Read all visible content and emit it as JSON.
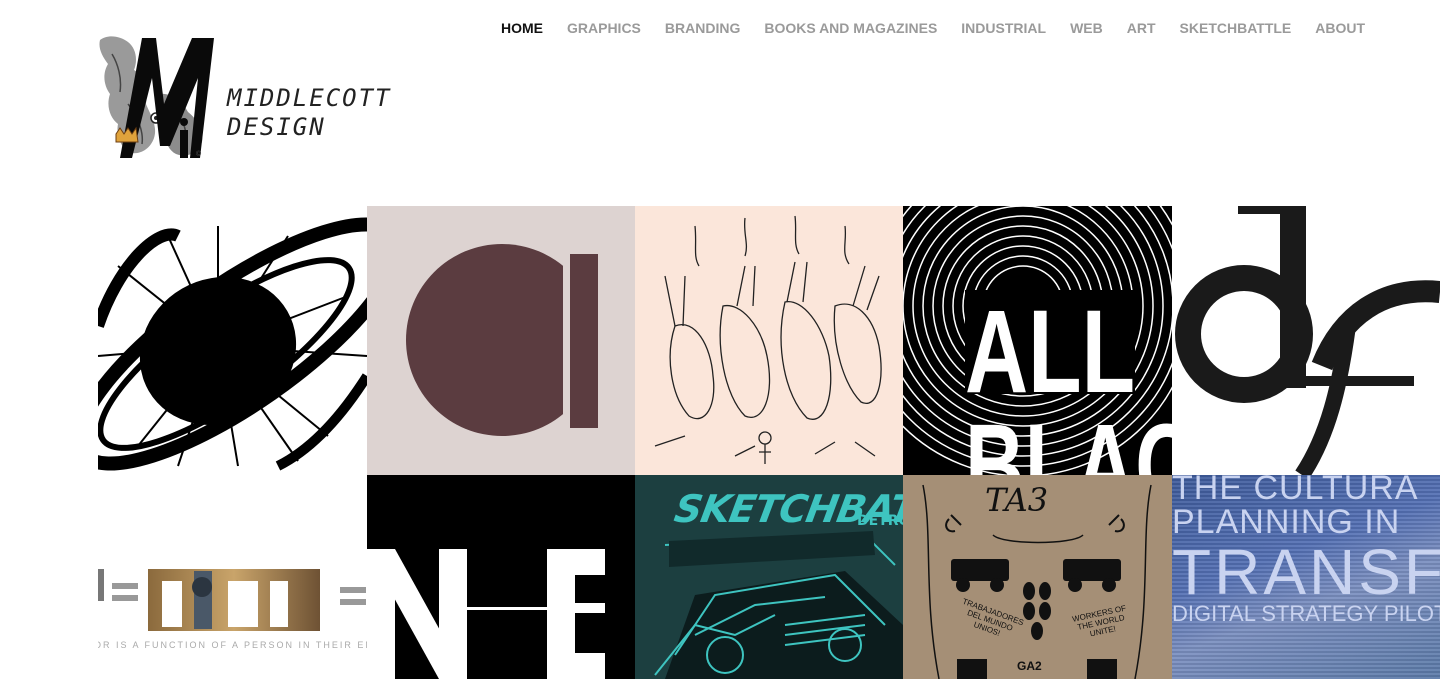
{
  "nav": {
    "items": [
      {
        "label": "HOME",
        "active": true
      },
      {
        "label": "GRAPHICS"
      },
      {
        "label": "BRANDING"
      },
      {
        "label": "BOOKS AND MAGAZINES"
      },
      {
        "label": "INDUSTRIAL"
      },
      {
        "label": "WEB"
      },
      {
        "label": "ART"
      },
      {
        "label": "SKETCHBATTLE"
      },
      {
        "label": "ABOUT"
      }
    ]
  },
  "logo": {
    "line1": "MIDDLECOTT",
    "line2": "DESIGN"
  },
  "tiles": {
    "t1": {
      "icon": "eclipse-artwork"
    },
    "t2": {
      "icon": "circle-bar-logo"
    },
    "t3": {
      "icon": "sketch-illustration"
    },
    "t4": {
      "text1": "ALL",
      "text2": "BLAC"
    },
    "t5": {
      "text": "df"
    },
    "t6": {
      "text": "B=F(P,E)",
      "caption": "OR IS A FUNCTION OF A PERSON IN THEIR ENVIRO"
    },
    "t7": {
      "text": "N-E"
    },
    "t8": {
      "title": "SKETCHBATT",
      "sub": "DETRO"
    },
    "t9": {
      "title": "TA3",
      "left_text": "TRABAJADORES DEL MUNDO UNIOS!",
      "right_text": "WORKERS OF THE WORLD UNITE!",
      "bottom": "GA2"
    },
    "t10": {
      "line1": "THE CULTURA",
      "line2": "PLANNING IN",
      "line3": "TRANSFO",
      "line4": "DIGITAL STRATEGY PILOT"
    }
  },
  "colors": {
    "nav_active": "#111111",
    "nav_inactive": "#9a9a9a",
    "tile2_bg": "#ddd3d1",
    "tile2_mark": "#5b3c40",
    "tile3_bg": "#fbe6da",
    "tile8_accent": "#3ec4c0",
    "tile9_bg": "#a58f76",
    "tile10_bg": "#4a5fa8"
  }
}
